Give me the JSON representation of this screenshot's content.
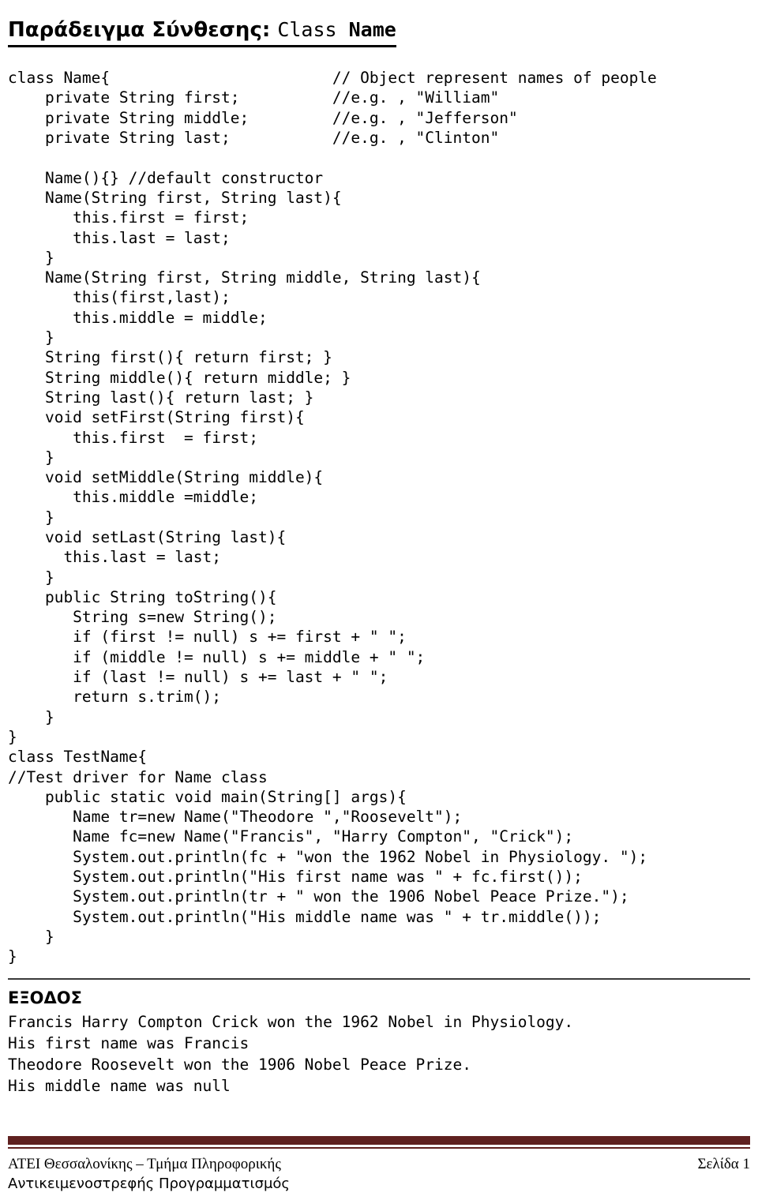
{
  "title": {
    "greek_part": "Παράδειγμα Σύνθεσης: ",
    "mono_regular_part": "Class ",
    "mono_bold_part": "Name"
  },
  "code": {
    "language": "java",
    "lines": [
      "class Name{                        // Object represent names of people",
      "    private String first;          //e.g. , \"William\"",
      "    private String middle;         //e.g. , \"Jefferson\"",
      "    private String last;           //e.g. , \"Clinton\"",
      "",
      "    Name(){} //default constructor",
      "    Name(String first, String last){",
      "       this.first = first;",
      "       this.last = last;",
      "    }",
      "    Name(String first, String middle, String last){",
      "       this(first,last);",
      "       this.middle = middle;",
      "    }",
      "    String first(){ return first; }",
      "    String middle(){ return middle; }",
      "    String last(){ return last; }",
      "    void setFirst(String first){",
      "       this.first  = first;",
      "    }",
      "    void setMiddle(String middle){",
      "       this.middle =middle;",
      "    }",
      "    void setLast(String last){",
      "      this.last = last;",
      "    }",
      "    public String toString(){",
      "       String s=new String();",
      "       if (first != null) s += first + \" \";",
      "       if (middle != null) s += middle + \" \";",
      "       if (last != null) s += last + \" \";",
      "       return s.trim();",
      "    }",
      "}",
      "class TestName{",
      "//Test driver for Name class",
      "    public static void main(String[] args){",
      "       Name tr=new Name(\"Theodore \",\"Roosevelt\");",
      "       Name fc=new Name(\"Francis\", \"Harry Compton\", \"Crick\");",
      "       System.out.println(fc + \"won the 1962 Nobel in Physiology. \");",
      "       System.out.println(\"His first name was \" + fc.first());",
      "       System.out.println(tr + \" won the 1906 Nobel Peace Prize.\");",
      "       System.out.println(\"His middle name was \" + tr.middle());",
      "    }",
      "}"
    ]
  },
  "output": {
    "heading": "ΕΞΟΔΟΣ",
    "lines": [
      "Francis Harry Compton Crick won the 1962 Nobel in Physiology.",
      "His first name was Francis",
      "Theodore Roosevelt won the 1906 Nobel Peace Prize.",
      "His middle name was null"
    ]
  },
  "footer": {
    "institution": "ΑΤΕΙ Θεσσαλονίκης – Τμήμα Πληροφορικής",
    "course": "Αντικειμενοστρεφής Προγραμματισμός",
    "page_label": "Σελίδα 1",
    "rule_color": "#5f2120"
  }
}
